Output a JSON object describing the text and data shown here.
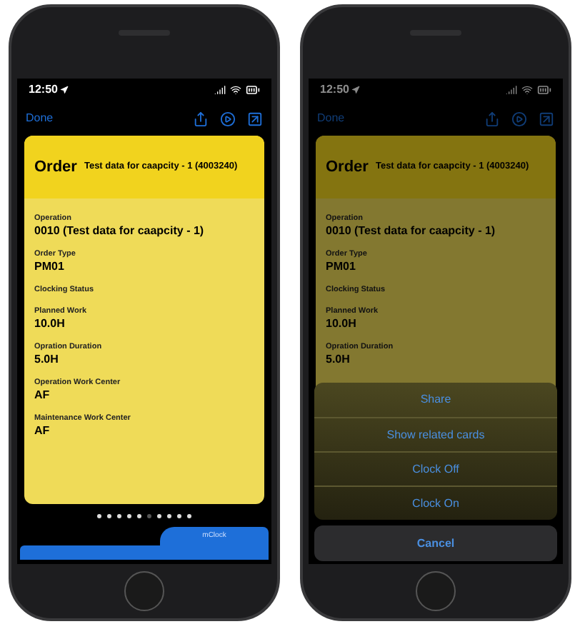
{
  "phones": [
    {
      "status_time": "12:50",
      "done": "Done",
      "card": {
        "title": "Order",
        "subtitle": "Test data for caapcity - 1 (4003240)",
        "fields": [
          {
            "label": "Operation",
            "value": "0010 (Test data for caapcity - 1)"
          },
          {
            "label": "Order Type",
            "value": "PM01"
          },
          {
            "label": "Clocking Status"
          },
          {
            "label": "Planned Work",
            "value": "10.0H"
          },
          {
            "label": "Opration Duration",
            "value": "5.0H"
          },
          {
            "label": "Operation Work Center",
            "value": "AF"
          },
          {
            "label": "Maintenance Work Center",
            "value": "AF"
          }
        ]
      },
      "page_dots": [
        {
          "selected": false
        },
        {
          "selected": false
        },
        {
          "selected": false
        },
        {
          "selected": false
        },
        {
          "selected": false
        },
        {
          "selected": true
        },
        {
          "selected": false
        },
        {
          "selected": false
        },
        {
          "selected": false
        },
        {
          "selected": false
        }
      ],
      "tab": "mClock"
    },
    {
      "status_time": "12:50",
      "done": "Done",
      "card": {
        "title": "Order",
        "subtitle": "Test data for caapcity - 1 (4003240)",
        "fields": [
          {
            "label": "Operation",
            "value": "0010 (Test data for caapcity - 1)"
          },
          {
            "label": "Order Type",
            "value": "PM01"
          },
          {
            "label": "Clocking Status"
          },
          {
            "label": "Planned Work",
            "value": "10.0H"
          },
          {
            "label": "Opration Duration",
            "value": "5.0H"
          }
        ]
      },
      "action_sheet": {
        "actions": [
          "Share",
          "Show related cards",
          "Clock Off",
          "Clock On"
        ],
        "cancel": "Cancel"
      }
    }
  ]
}
